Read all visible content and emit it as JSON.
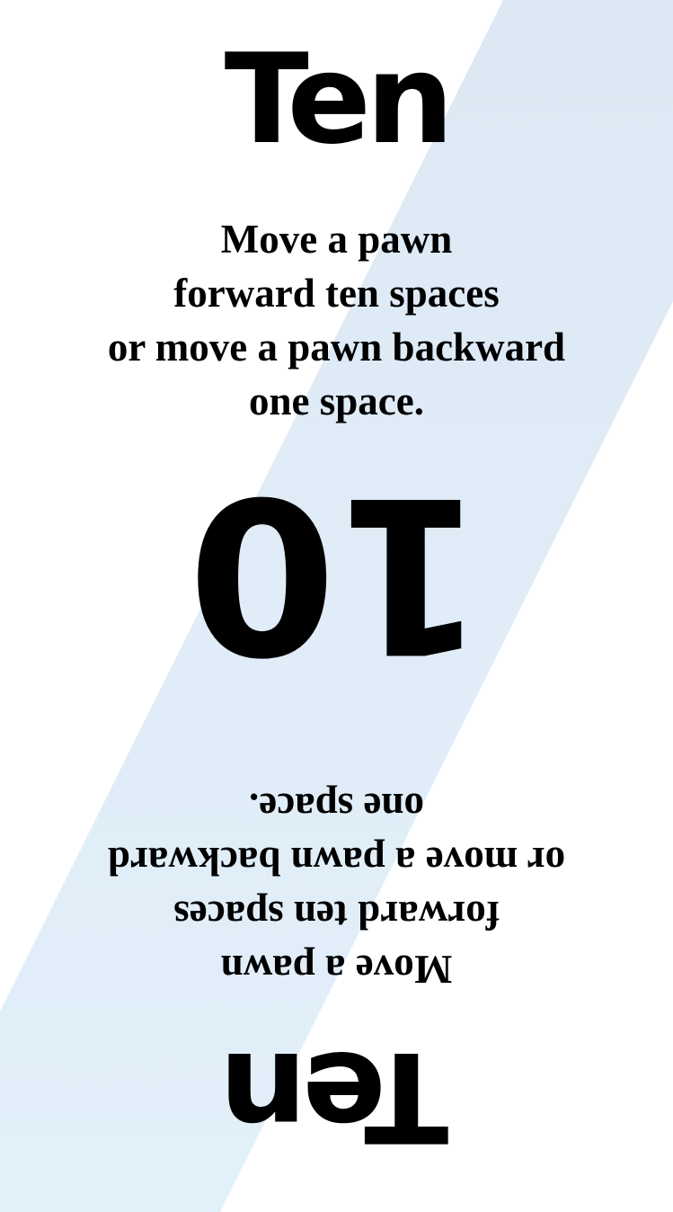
{
  "card": {
    "title": "Ten",
    "rule_lines": [
      "Move a pawn",
      "forward ten spaces",
      "or move a pawn backward",
      "one space."
    ],
    "number": "10"
  },
  "colors": {
    "background": "#ffffff",
    "stripe_top": "#dde8f4",
    "stripe_bottom": "#e2f0fa",
    "text": "#000000"
  }
}
